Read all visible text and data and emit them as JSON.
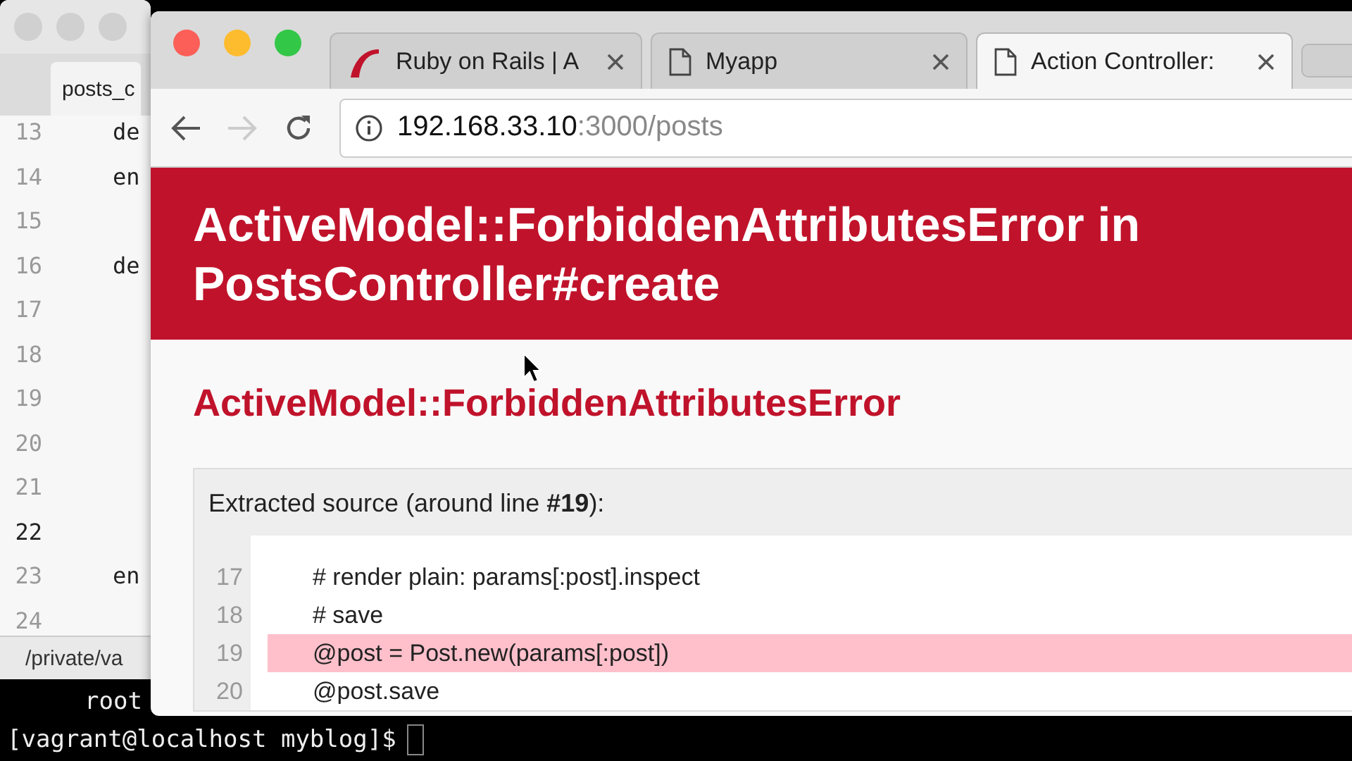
{
  "editor": {
    "tab": "posts_c",
    "lines": [
      {
        "number": "13",
        "code": "de",
        "current": false
      },
      {
        "number": "14",
        "code": "en",
        "current": false
      },
      {
        "number": "15",
        "current": false
      },
      {
        "number": "16",
        "code": "de",
        "current": false
      },
      {
        "number": "17",
        "current": false
      },
      {
        "number": "18",
        "current": false
      },
      {
        "number": "19",
        "current": false
      },
      {
        "number": "20",
        "current": false
      },
      {
        "number": "21",
        "current": false
      },
      {
        "number": "22",
        "current": true
      },
      {
        "number": "23",
        "code": "en",
        "current": false
      },
      {
        "number": "24",
        "current": false
      }
    ],
    "status_bar": "/private/va"
  },
  "terminal": {
    "lines": [
      "root",
      "[vagrant@localhost myblog]$"
    ]
  },
  "browser": {
    "tabs": [
      {
        "kind": "rails",
        "label": "Ruby on Rails | A",
        "selected": false
      },
      {
        "kind": "page",
        "label": "Myapp",
        "selected": false
      },
      {
        "kind": "page",
        "label": "Action Controller:",
        "selected": true
      }
    ],
    "address": {
      "host": "192.168.33.10",
      "path": ":3000/posts"
    },
    "page": {
      "title_lines": [
        "ActiveModel::ForbiddenAttributesError in",
        "PostsController#create"
      ],
      "subtitle": "ActiveModel::ForbiddenAttributesError",
      "source": {
        "heading": "Extracted source (around line **#19**):",
        "lines": [
          {
            "number": "17",
            "code": "# render plain: params[:post].inspect",
            "highlighted": false
          },
          {
            "number": "18",
            "code": "# save",
            "highlighted": false
          },
          {
            "number": "19",
            "code": "@post = Post.new(params[:post])",
            "highlighted": true
          },
          {
            "number": "20",
            "code": "@post.save",
            "highlighted": false
          }
        ]
      }
    }
  }
}
